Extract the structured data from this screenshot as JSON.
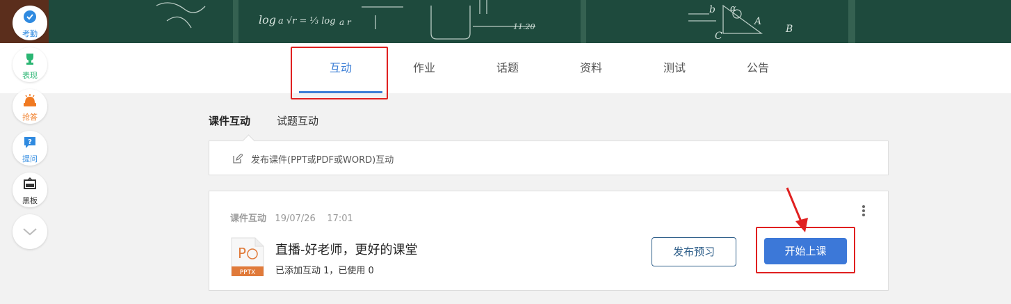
{
  "sidebar": {
    "items": [
      {
        "label": "考勤",
        "icon": "check-pin-icon",
        "color": "#2f8ae0"
      },
      {
        "label": "表现",
        "icon": "trophy-icon",
        "color": "#2bb673"
      },
      {
        "label": "抢答",
        "icon": "buzzer-icon",
        "color": "#f07a22"
      },
      {
        "label": "提问",
        "icon": "question-icon",
        "color": "#2f8ae0"
      },
      {
        "label": "黑板",
        "icon": "blackboard-icon",
        "color": "#333333"
      }
    ],
    "expand_icon": "chevron-down-icon"
  },
  "tabs": [
    {
      "label": "互动",
      "active": true
    },
    {
      "label": "作业",
      "active": false
    },
    {
      "label": "话题",
      "active": false
    },
    {
      "label": "资料",
      "active": false
    },
    {
      "label": "测试",
      "active": false
    },
    {
      "label": "公告",
      "active": false
    }
  ],
  "subtabs": [
    {
      "label": "课件互动",
      "active": true
    },
    {
      "label": "试题互动",
      "active": false
    }
  ],
  "publish": {
    "label": "发布课件(PPT或PDF或WORD)互动",
    "icon": "edit-icon"
  },
  "card": {
    "type": "课件互动",
    "date": "19/07/26",
    "time": "17:01",
    "file_type": "PPTX",
    "title": "直播-好老师，更好的课堂",
    "stats": "已添加互动 1，已使用 0",
    "preview_button": "发布预习",
    "start_button": "开始上课"
  },
  "colors": {
    "accent": "#3d7fd6",
    "highlight": "#e02020",
    "banner": "#1e4a3d"
  }
}
